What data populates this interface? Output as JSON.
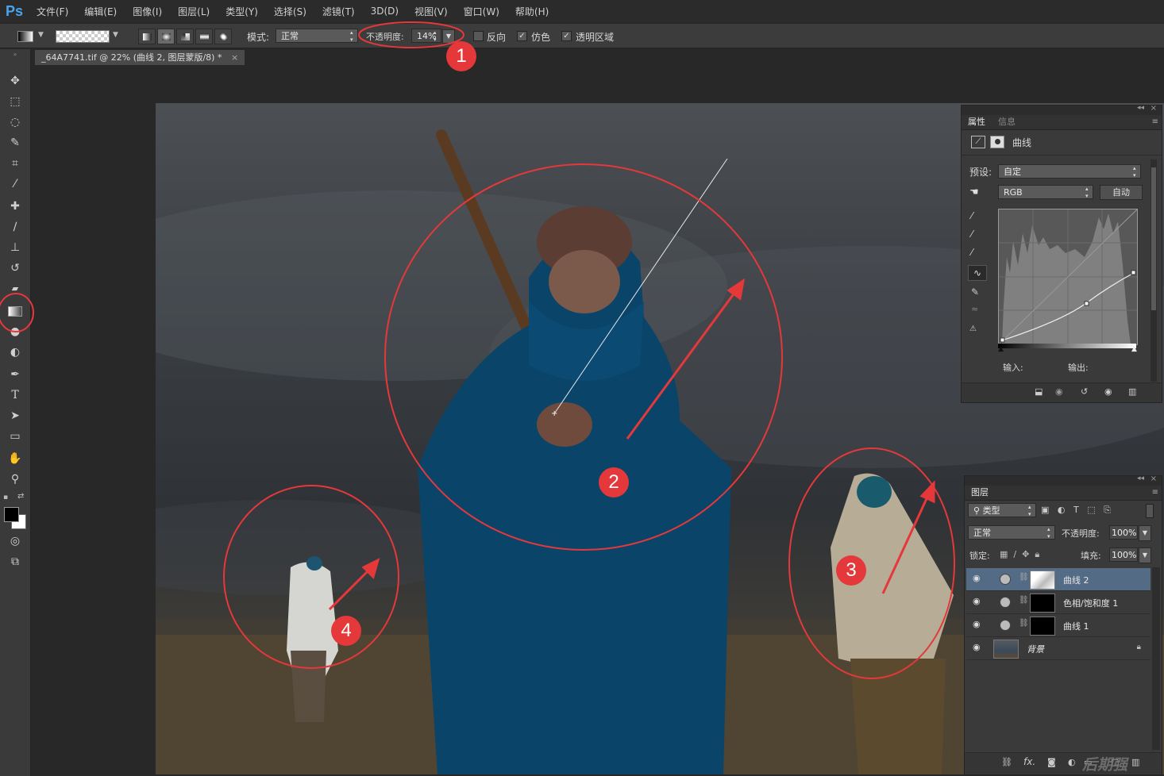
{
  "app": {
    "logo": "Ps"
  },
  "menu": [
    "文件(F)",
    "编辑(E)",
    "图像(I)",
    "图层(L)",
    "类型(Y)",
    "选择(S)",
    "滤镜(T)",
    "3D(D)",
    "视图(V)",
    "窗口(W)",
    "帮助(H)"
  ],
  "options": {
    "mode_label": "模式:",
    "mode_value": "正常",
    "opacity_label": "不透明度:",
    "opacity_value": "14%",
    "reverse_label": "反向",
    "reverse_checked": false,
    "dither_label": "仿色",
    "dither_checked": true,
    "transparency_label": "透明区域",
    "transparency_checked": true
  },
  "document": {
    "tab_title": "_64A7741.tif @ 22% (曲线 2, 图层蒙版/8) *",
    "close": "×"
  },
  "colors": {
    "foreground": "#000000",
    "background": "#ffffff",
    "accent_annotation": "#e5383b",
    "selected_layer": "#546b85"
  },
  "tools": [
    "move-icon",
    "marquee-icon",
    "lasso-icon",
    "quick-select-icon",
    "crop-icon",
    "eyedropper-icon",
    "healing-icon",
    "brush-icon",
    "stamp-icon",
    "history-brush-icon",
    "eraser-icon",
    "gradient-icon",
    "blur-icon",
    "dodge-icon",
    "pen-icon",
    "type-icon",
    "path-select-icon",
    "shape-icon",
    "hand-icon",
    "zoom-icon"
  ],
  "properties_panel": {
    "tabs": [
      "属性",
      "信息"
    ],
    "type_label": "曲线",
    "preset_label": "预设:",
    "preset_value": "自定",
    "channel_value": "RGB",
    "auto_label": "自动",
    "input_label": "输入:",
    "output_label": "输出:"
  },
  "layers_panel": {
    "tab": "图层",
    "filter_value": "类型",
    "blend_mode": "正常",
    "opacity_label": "不透明度:",
    "opacity_value": "100%",
    "lock_label": "锁定:",
    "fill_label": "填充:",
    "fill_value": "100%",
    "layers": [
      {
        "name": "曲线 2",
        "selected": true
      },
      {
        "name": "色相/饱和度 1",
        "selected": false
      },
      {
        "name": "曲线 1",
        "selected": false
      },
      {
        "name": "背景",
        "selected": false,
        "locked": true
      }
    ],
    "watermark": "后期强"
  },
  "annotations": [
    "1",
    "2",
    "3",
    "4"
  ]
}
